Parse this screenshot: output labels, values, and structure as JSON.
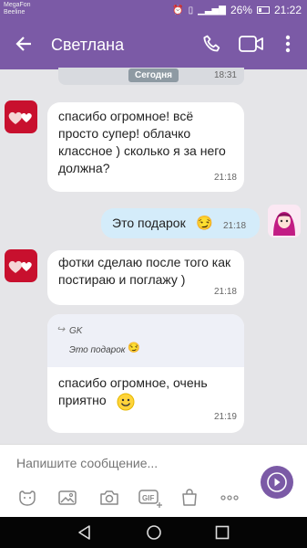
{
  "status_bar": {
    "carrier1": "MegaFon",
    "carrier2": "Beeline",
    "battery": "26%",
    "time": "21:22"
  },
  "header": {
    "contact_name": "Светлана"
  },
  "date_banner": {
    "label": "Сегодня",
    "time": "18:31"
  },
  "messages": [
    {
      "direction": "in",
      "text": "спасибо огромное! всё просто супер! облачко классное ) сколько я за него должна?",
      "time": "21:18"
    },
    {
      "direction": "out",
      "text": "Это подарок",
      "time": "21:18"
    },
    {
      "direction": "in",
      "text": "фотки сделаю после того как постираю и поглажу  )",
      "time": "21:18"
    },
    {
      "direction": "in",
      "reply_author": "GK",
      "reply_text": "Это подарок",
      "text": "спасибо огромное, очень приятно",
      "time": "21:19"
    }
  ],
  "composer": {
    "placeholder": "Напишите сообщение..."
  },
  "colors": {
    "accent": "#7b5aa6",
    "incoming_bubble": "#ffffff",
    "outgoing_bubble": "#d4ecfa",
    "chat_background": "#e5e5e8"
  }
}
